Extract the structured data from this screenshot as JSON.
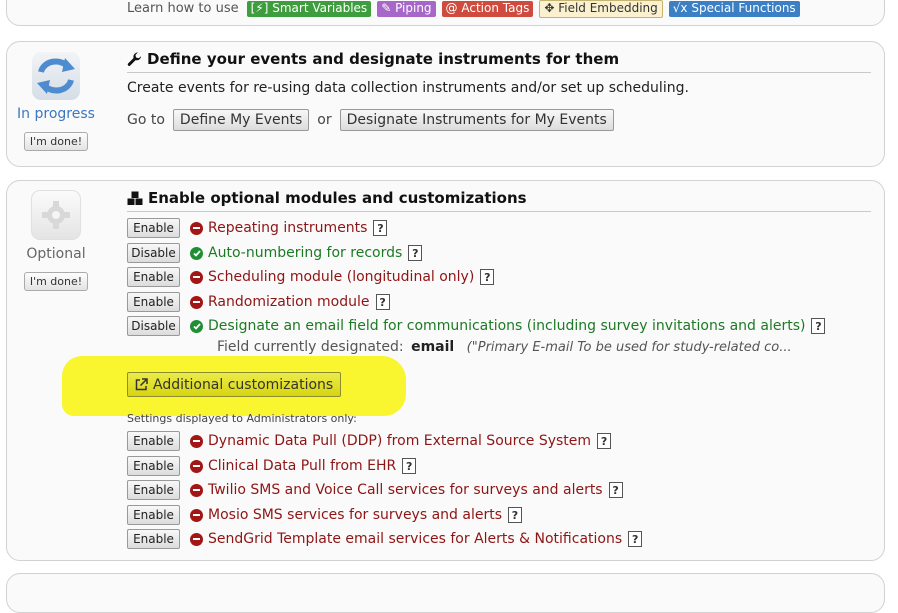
{
  "learn": {
    "label": "Learn how to use",
    "tags": [
      {
        "text": "[⚡] Smart Variables",
        "color": "#3e9e3e"
      },
      {
        "text": "Piping",
        "color": "#a667c8"
      },
      {
        "text": "@ Action Tags",
        "color": "#cf4b3d"
      },
      {
        "text": "Field Embedding",
        "color": "#fbf1cf"
      },
      {
        "text": "Special Functions",
        "color": "#3b7fc4"
      }
    ]
  },
  "events_section": {
    "status": "In progress",
    "status_color": "#3b78c0",
    "done_button": "I'm done!",
    "title": "Define your events and designate instruments for them",
    "description": "Create events for re-using data collection instruments and/or set up scheduling.",
    "goto_label": "Go to",
    "or_label": "or",
    "define_button": "Define My Events",
    "designate_button": "Designate Instruments for My Events"
  },
  "modules_section": {
    "status": "Optional",
    "done_button": "I'm done!",
    "title": "Enable optional modules and customizations",
    "modules": [
      {
        "button": "Enable",
        "label": "Repeating instruments",
        "enabled": false
      },
      {
        "button": "Disable",
        "label": "Auto-numbering for records",
        "enabled": true
      },
      {
        "button": "Enable",
        "label": "Scheduling module (longitudinal only)",
        "enabled": false
      },
      {
        "button": "Enable",
        "label": "Randomization module",
        "enabled": false
      },
      {
        "button": "Disable",
        "label": "Designate an email field for communications (including survey invitations and alerts)",
        "enabled": true
      }
    ],
    "email_field": {
      "label": "Field currently designated:",
      "value": "email",
      "note": "(\"Primary E-mail To be used for study-related co..."
    },
    "customizations_button": "Additional customizations",
    "admin_note": "Settings displayed to Administrators only:",
    "admin_modules": [
      {
        "button": "Enable",
        "label": "Dynamic Data Pull (DDP) from External Source System",
        "enabled": false
      },
      {
        "button": "Enable",
        "label": "Clinical Data Pull from EHR",
        "enabled": false
      },
      {
        "button": "Enable",
        "label": "Twilio SMS and Voice Call services for surveys and alerts",
        "enabled": false
      },
      {
        "button": "Enable",
        "label": "Mosio SMS services for surveys and alerts",
        "enabled": false
      },
      {
        "button": "Enable",
        "label": "SendGrid Template email services for Alerts & Notifications",
        "enabled": false
      }
    ]
  },
  "help_glyph": "?"
}
